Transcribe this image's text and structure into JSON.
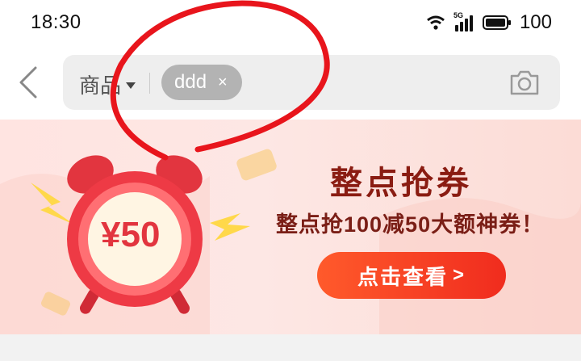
{
  "status_bar": {
    "time": "18:30",
    "network_label": "5G",
    "battery": "100"
  },
  "search": {
    "category": "商品",
    "chip_text": "ddd",
    "chip_close": "×"
  },
  "banner": {
    "title": "整点抢券",
    "subtitle": "整点抢100减50大额神券！",
    "cta_label": "点击查看",
    "coupon_text": "¥50",
    "colors": {
      "accent": "#f02c1e",
      "title": "#8a1c12",
      "clock": "#e8323c"
    }
  },
  "icons": [
    "back-chevron-icon",
    "wifi-icon",
    "signal-icon",
    "battery-icon",
    "dropdown-icon",
    "camera-icon",
    "alarm-clock-icon"
  ]
}
